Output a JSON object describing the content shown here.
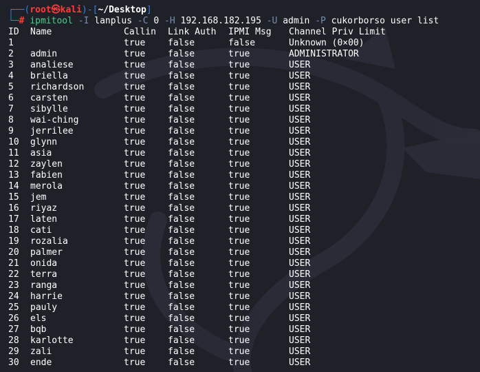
{
  "prompt": {
    "corner_top": "┌──(",
    "user": "root",
    "skull": "㉿",
    "host": "kali",
    "sep": ")-[",
    "path": "~/Desktop",
    "close": "]",
    "corner_bottom": "└─",
    "hash": "#"
  },
  "command": {
    "program": "ipmitool",
    "opt_i": "-I",
    "val_i": "lanplus",
    "opt_c": "-C",
    "val_c": "0",
    "opt_h": "-H",
    "val_h": "192.168.182.195",
    "opt_u": "-U",
    "val_u": "admin",
    "opt_p": "-P",
    "val_p": "cukorborso",
    "sub1": "user",
    "sub2": "list"
  },
  "table": {
    "headers": {
      "id": "ID",
      "name": "Name",
      "callin": "Callin",
      "link": "Link Auth",
      "ipmi": "IPMI Msg",
      "priv": "Channel Priv Limit"
    },
    "rows": [
      {
        "id": "1",
        "name": "",
        "callin": "true",
        "link": "false",
        "ipmi": "false",
        "priv": "Unknown (0×00)"
      },
      {
        "id": "2",
        "name": "admin",
        "callin": "true",
        "link": "false",
        "ipmi": "true",
        "priv": "ADMINISTRATOR"
      },
      {
        "id": "3",
        "name": "analiese",
        "callin": "true",
        "link": "false",
        "ipmi": "true",
        "priv": "USER"
      },
      {
        "id": "4",
        "name": "briella",
        "callin": "true",
        "link": "false",
        "ipmi": "true",
        "priv": "USER"
      },
      {
        "id": "5",
        "name": "richardson",
        "callin": "true",
        "link": "false",
        "ipmi": "true",
        "priv": "USER"
      },
      {
        "id": "6",
        "name": "carsten",
        "callin": "true",
        "link": "false",
        "ipmi": "true",
        "priv": "USER"
      },
      {
        "id": "7",
        "name": "sibylle",
        "callin": "true",
        "link": "false",
        "ipmi": "true",
        "priv": "USER"
      },
      {
        "id": "8",
        "name": "wai-ching",
        "callin": "true",
        "link": "false",
        "ipmi": "true",
        "priv": "USER"
      },
      {
        "id": "9",
        "name": "jerrilee",
        "callin": "true",
        "link": "false",
        "ipmi": "true",
        "priv": "USER"
      },
      {
        "id": "10",
        "name": "glynn",
        "callin": "true",
        "link": "false",
        "ipmi": "true",
        "priv": "USER"
      },
      {
        "id": "11",
        "name": "asia",
        "callin": "true",
        "link": "false",
        "ipmi": "true",
        "priv": "USER"
      },
      {
        "id": "12",
        "name": "zaylen",
        "callin": "true",
        "link": "false",
        "ipmi": "true",
        "priv": "USER"
      },
      {
        "id": "13",
        "name": "fabien",
        "callin": "true",
        "link": "false",
        "ipmi": "true",
        "priv": "USER"
      },
      {
        "id": "14",
        "name": "merola",
        "callin": "true",
        "link": "false",
        "ipmi": "true",
        "priv": "USER"
      },
      {
        "id": "15",
        "name": "jem",
        "callin": "true",
        "link": "false",
        "ipmi": "true",
        "priv": "USER"
      },
      {
        "id": "16",
        "name": "riyaz",
        "callin": "true",
        "link": "false",
        "ipmi": "true",
        "priv": "USER"
      },
      {
        "id": "17",
        "name": "laten",
        "callin": "true",
        "link": "false",
        "ipmi": "true",
        "priv": "USER"
      },
      {
        "id": "18",
        "name": "cati",
        "callin": "true",
        "link": "false",
        "ipmi": "true",
        "priv": "USER"
      },
      {
        "id": "19",
        "name": "rozalia",
        "callin": "true",
        "link": "false",
        "ipmi": "true",
        "priv": "USER"
      },
      {
        "id": "20",
        "name": "palmer",
        "callin": "true",
        "link": "false",
        "ipmi": "true",
        "priv": "USER"
      },
      {
        "id": "21",
        "name": "onida",
        "callin": "true",
        "link": "false",
        "ipmi": "true",
        "priv": "USER"
      },
      {
        "id": "22",
        "name": "terra",
        "callin": "true",
        "link": "false",
        "ipmi": "true",
        "priv": "USER"
      },
      {
        "id": "23",
        "name": "ranga",
        "callin": "true",
        "link": "false",
        "ipmi": "true",
        "priv": "USER"
      },
      {
        "id": "24",
        "name": "harrie",
        "callin": "true",
        "link": "false",
        "ipmi": "true",
        "priv": "USER"
      },
      {
        "id": "25",
        "name": "pauly",
        "callin": "true",
        "link": "false",
        "ipmi": "true",
        "priv": "USER"
      },
      {
        "id": "26",
        "name": "els",
        "callin": "true",
        "link": "false",
        "ipmi": "true",
        "priv": "USER"
      },
      {
        "id": "27",
        "name": "bqb",
        "callin": "true",
        "link": "false",
        "ipmi": "true",
        "priv": "USER"
      },
      {
        "id": "28",
        "name": "karlotte",
        "callin": "true",
        "link": "false",
        "ipmi": "true",
        "priv": "USER"
      },
      {
        "id": "29",
        "name": "zali",
        "callin": "true",
        "link": "false",
        "ipmi": "true",
        "priv": "USER"
      },
      {
        "id": "30",
        "name": "ende",
        "callin": "true",
        "link": "false",
        "ipmi": "true",
        "priv": "USER"
      }
    ]
  },
  "colors": {
    "background": "#1f2129",
    "prompt_frame": "#3b7bd8",
    "prompt_user": "#ff3b3b",
    "command": "#4ccd8a",
    "option": "#7a8bb0",
    "text": "#ffffff"
  },
  "icons": {
    "watermark": "kali-dragon-logo-icon"
  }
}
